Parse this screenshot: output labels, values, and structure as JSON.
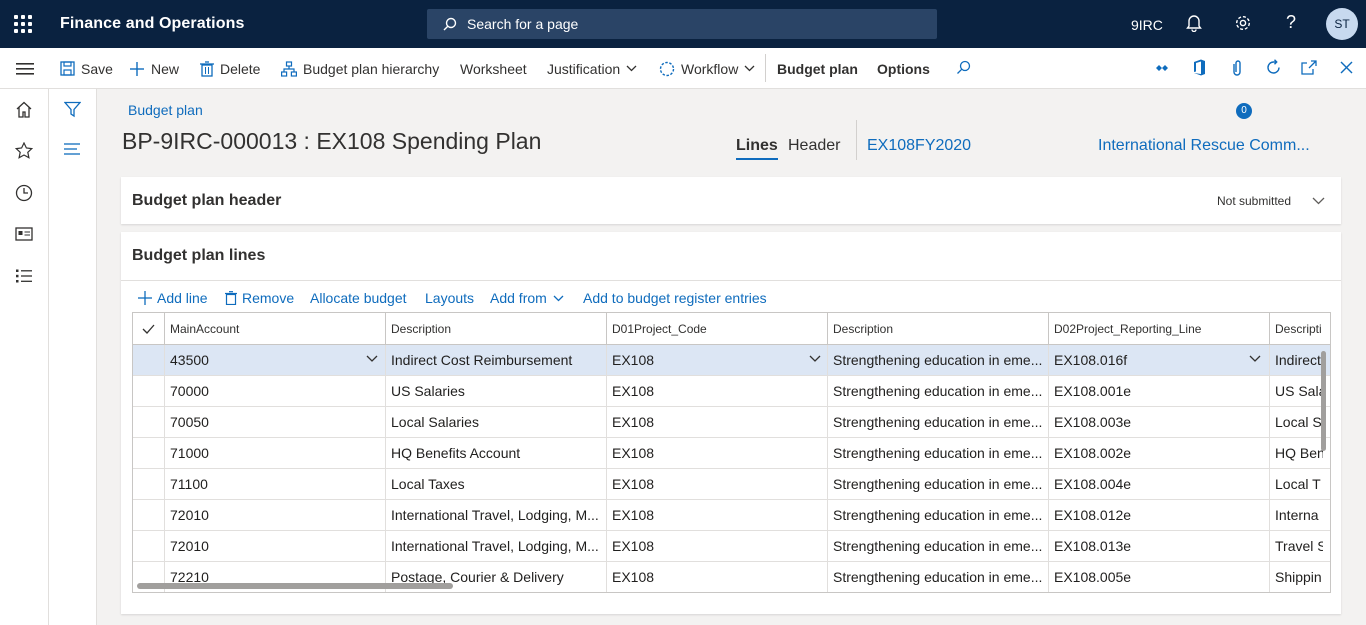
{
  "topbar": {
    "app_title": "Finance and Operations",
    "search_placeholder": "Search for a page",
    "company": "9IRC",
    "avatar_initials": "ST"
  },
  "actions": {
    "save": "Save",
    "new": "New",
    "delete": "Delete",
    "hierarchy": "Budget plan hierarchy",
    "worksheet": "Worksheet",
    "justification": "Justification",
    "workflow": "Workflow",
    "budget_plan": "Budget plan",
    "options": "Options",
    "attachments_count": "0"
  },
  "page": {
    "breadcrumb": "Budget plan",
    "title": "BP-9IRC-000013 : EX108 Spending Plan",
    "tabs": [
      "Lines",
      "Header"
    ],
    "link1": "EX108FY2020",
    "link2": "International Rescue Comm..."
  },
  "header_section": {
    "title": "Budget plan header",
    "status": "Not submitted"
  },
  "lines_section": {
    "title": "Budget plan lines",
    "toolbar": {
      "add_line": "Add line",
      "remove": "Remove",
      "allocate": "Allocate budget",
      "layouts": "Layouts",
      "add_from": "Add from",
      "add_register": "Add to budget register entries"
    },
    "columns": [
      "MainAccount",
      "Description",
      "D01Project_Code",
      "Description",
      "D02Project_Reporting_Line",
      "Descripti"
    ],
    "rows": [
      [
        "43500",
        "Indirect Cost Reimbursement",
        "EX108",
        "Strengthening education in eme...",
        "EX108.016f",
        "Indirect"
      ],
      [
        "70000",
        "US Salaries",
        "EX108",
        "Strengthening education in eme...",
        "EX108.001e",
        "US Sala"
      ],
      [
        "70050",
        "Local Salaries",
        "EX108",
        "Strengthening education in eme...",
        "EX108.003e",
        "Local S"
      ],
      [
        "71000",
        "HQ Benefits Account",
        "EX108",
        "Strengthening education in eme...",
        "EX108.002e",
        "HQ Ben"
      ],
      [
        "71100",
        "Local Taxes",
        "EX108",
        "Strengthening education in eme...",
        "EX108.004e",
        "Local T"
      ],
      [
        "72010",
        "International Travel, Lodging, M...",
        "EX108",
        "Strengthening education in eme...",
        "EX108.012e",
        "Interna"
      ],
      [
        "72010",
        "International Travel, Lodging, M...",
        "EX108",
        "Strengthening education in eme...",
        "EX108.013e",
        "Travel S"
      ],
      [
        "72210",
        "Postage, Courier & Delivery",
        "EX108",
        "Strengthening education in eme...",
        "EX108.005e",
        "Shippin"
      ]
    ]
  }
}
